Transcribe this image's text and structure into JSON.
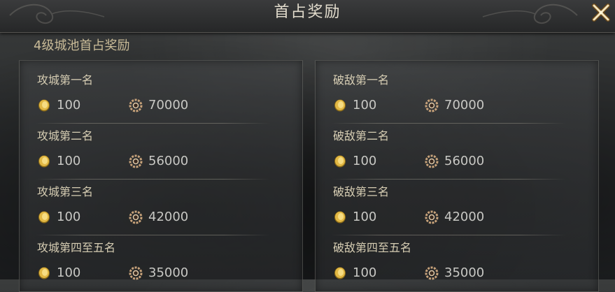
{
  "header": {
    "title": "首占奖励"
  },
  "section": {
    "title": "4级城池首占奖励"
  },
  "icons": {
    "gold": "gold-coin-icon",
    "silver": "coin-string-icon",
    "close": "close-icon"
  },
  "panels": [
    {
      "ranks": [
        {
          "title": "攻城第一名",
          "gold": "100",
          "silver": "70000"
        },
        {
          "title": "攻城第二名",
          "gold": "100",
          "silver": "56000"
        },
        {
          "title": "攻城第三名",
          "gold": "100",
          "silver": "42000"
        },
        {
          "title": "攻城第四至五名",
          "gold": "100",
          "silver": "35000"
        }
      ]
    },
    {
      "ranks": [
        {
          "title": "破敌第一名",
          "gold": "100",
          "silver": "70000"
        },
        {
          "title": "破敌第二名",
          "gold": "100",
          "silver": "56000"
        },
        {
          "title": "破敌第三名",
          "gold": "100",
          "silver": "42000"
        },
        {
          "title": "破敌第四至五名",
          "gold": "100",
          "silver": "35000"
        }
      ]
    }
  ]
}
